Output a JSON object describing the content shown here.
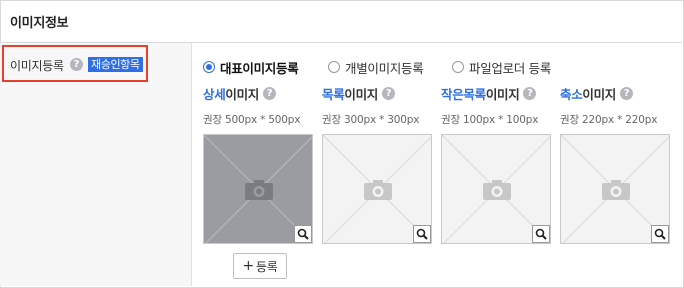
{
  "section": {
    "title": "이미지정보"
  },
  "field": {
    "label": "이미지등록",
    "help": "?",
    "badge": "재승인항목"
  },
  "modes": [
    {
      "label": "대표이미지등록",
      "selected": true
    },
    {
      "label": "개별이미지등록",
      "selected": false
    },
    {
      "label": "파일업로더 등록",
      "selected": false
    }
  ],
  "images": [
    {
      "accent": "상세",
      "rest": "이미지",
      "recommend": "권장 500px * 500px",
      "active": true
    },
    {
      "accent": "목록",
      "rest": "이미지",
      "recommend": "권장 300px * 300px",
      "active": false
    },
    {
      "accent": "작은목록",
      "rest": "이미지",
      "recommend": "권장 100px * 100px",
      "active": false
    },
    {
      "accent": "축소",
      "rest": "이미지",
      "recommend": "권장 220px * 220px",
      "active": false
    }
  ],
  "register_button": {
    "label": "등록",
    "icon": "plus-icon"
  },
  "colors": {
    "accent": "#2e6fe6",
    "highlight_border": "#e8402f",
    "badge_bg": "#2e6fe6"
  }
}
